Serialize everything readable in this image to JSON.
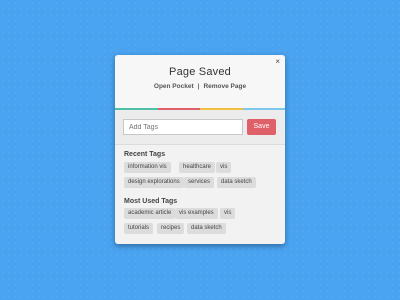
{
  "popup": {
    "close_glyph": "×",
    "title": "Page Saved",
    "open_pocket": "Open Pocket",
    "separator": "|",
    "remove_page": "Remove Page",
    "accent_colors": [
      "#4fc0a8",
      "#e0606a",
      "#f0c040",
      "#7ec8f0"
    ]
  },
  "tagging": {
    "placeholder": "Add Tags",
    "save_label": "Save",
    "save_color": "#e0606a"
  },
  "recent_tags": {
    "title": "Recent Tags",
    "items": [
      "information vis",
      "healthcare",
      "vis",
      "design explorations",
      "services",
      "data sketch"
    ]
  },
  "most_used_tags": {
    "title": "Most Used Tags",
    "items": [
      "academic article",
      "vis examples",
      "vis",
      "tutorials",
      "recipes",
      "data sketch"
    ]
  }
}
